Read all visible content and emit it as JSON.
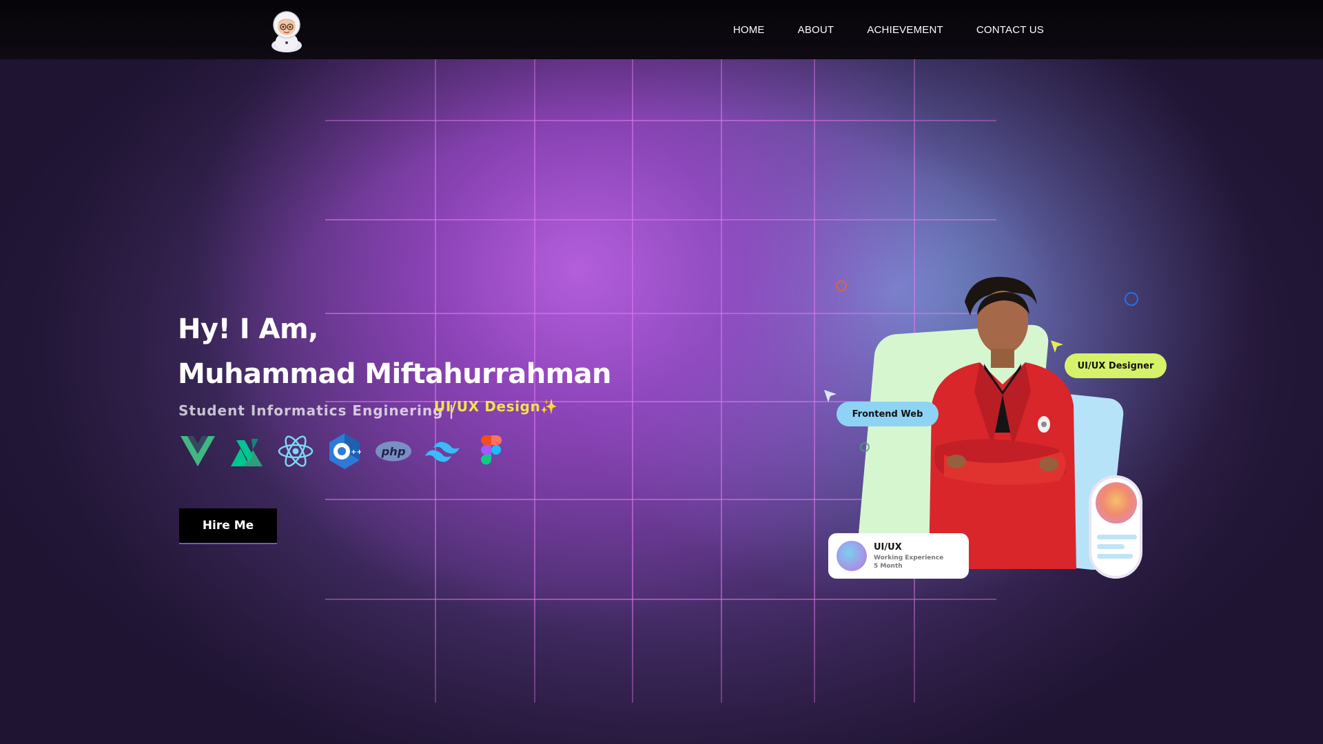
{
  "nav": {
    "logo_alt": "astronaut-avatar",
    "items": [
      {
        "label": "HOME"
      },
      {
        "label": "ABOUT"
      },
      {
        "label": "ACHIEVEMENT"
      },
      {
        "label": "CONTACT US"
      }
    ]
  },
  "hero": {
    "greeting": "Hy! I Am,",
    "name": "Muhammad Miftahurrahman",
    "subtitle": "Student Informatics Enginering |",
    "role": "UI/UX Design",
    "role_emoji": "✨",
    "tech_icons": [
      "vue-icon",
      "nuxt-icon",
      "react-icon",
      "cplusplus-icon",
      "php-icon",
      "tailwind-icon",
      "figma-icon"
    ],
    "php_text": "php",
    "cpp_text": "C++",
    "cta": "Hire Me"
  },
  "illustration": {
    "frontend_pill": "Frontend Web",
    "uiux_pill": "UI/UX Designer",
    "exp_card": {
      "title": "UI/UX",
      "subtitle": "Working Experience",
      "duration": "5 Month"
    }
  },
  "colors": {
    "accent_yellow": "#f3e24a",
    "pill_green": "#d6f26a",
    "pill_blue": "#8ed3f4",
    "nav_bg": "#0a070d"
  }
}
